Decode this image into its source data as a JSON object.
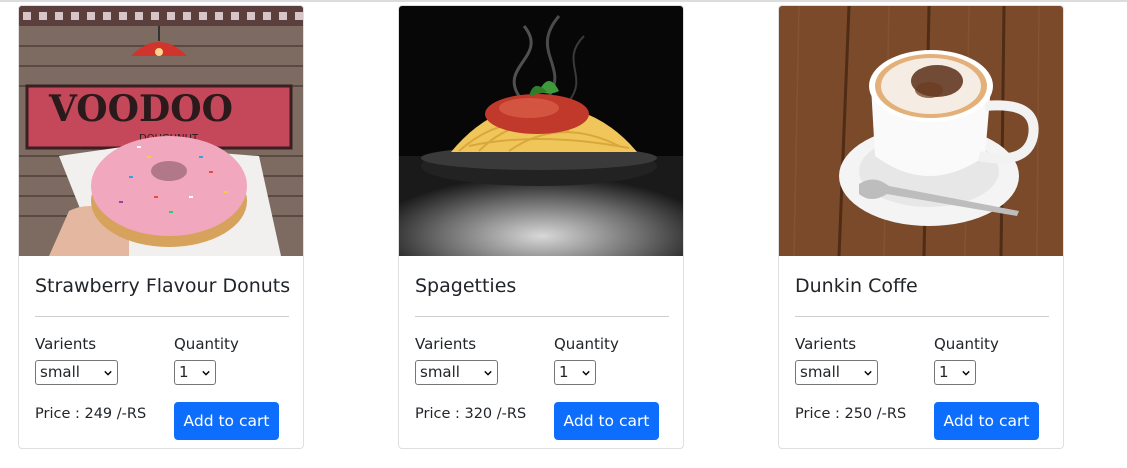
{
  "products": [
    {
      "title": "Strawberry Flavour Donuts",
      "varients_label": "Varients",
      "quantity_label": "Quantity",
      "variant_selected": "small",
      "quantity_selected": "1",
      "price": "Price : 249 /-RS",
      "button": "Add to cart",
      "image_sign_text": "VOODOO",
      "image_sign_subtext": "DOUGHNUT"
    },
    {
      "title": "Spagetties",
      "varients_label": "Varients",
      "quantity_label": "Quantity",
      "variant_selected": "small",
      "quantity_selected": "1",
      "price": "Price : 320 /-RS",
      "button": "Add to cart"
    },
    {
      "title": "Dunkin Coffe",
      "varients_label": "Varients",
      "quantity_label": "Quantity",
      "variant_selected": "small",
      "quantity_selected": "1",
      "price": "Price : 250 /-RS",
      "button": "Add to cart"
    }
  ],
  "colors": {
    "primary_button": "#0d6efd",
    "card_border": "#dfdfdf"
  },
  "icons": {
    "select_arrow": "chevron-down-icon"
  }
}
